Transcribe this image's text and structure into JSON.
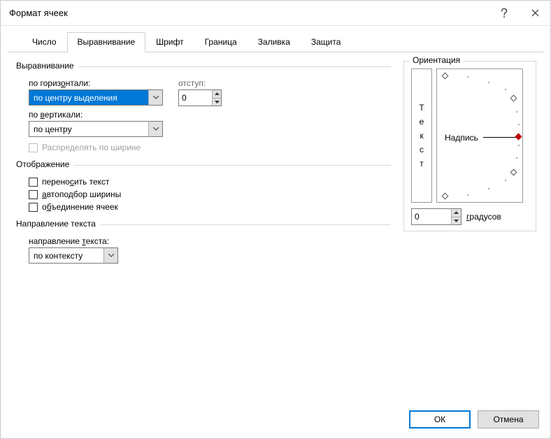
{
  "window": {
    "title": "Формат ячеек"
  },
  "tabs": {
    "number": "Число",
    "alignment": "Выравнивание",
    "font": "Шрифт",
    "border": "Граница",
    "fill": "Заливка",
    "protection": "Защита"
  },
  "alignment": {
    "legend": "Выравнивание",
    "horizontal_label": "по горизонтали:",
    "horizontal_value": "по центру выделения",
    "vertical_label": "по вертикали:",
    "vertical_value": "по центру",
    "indent_label": "отступ:",
    "indent_value": "0",
    "distribute_label": "Распределять по ширине"
  },
  "display": {
    "legend": "Отображение",
    "wrap_text": "переносить текст",
    "shrink_to_fit": "автоподбор ширины",
    "merge_cells": "объединение ячеек"
  },
  "text_direction": {
    "legend": "Направление текста",
    "label": "направление текста:",
    "value": "по контексту"
  },
  "orientation": {
    "legend": "Ориентация",
    "vertical_word": "Текст",
    "horizontal_word": "Надпись",
    "degrees_value": "0",
    "degrees_label": "градусов"
  },
  "buttons": {
    "ok": "ОК",
    "cancel": "Отмена"
  }
}
